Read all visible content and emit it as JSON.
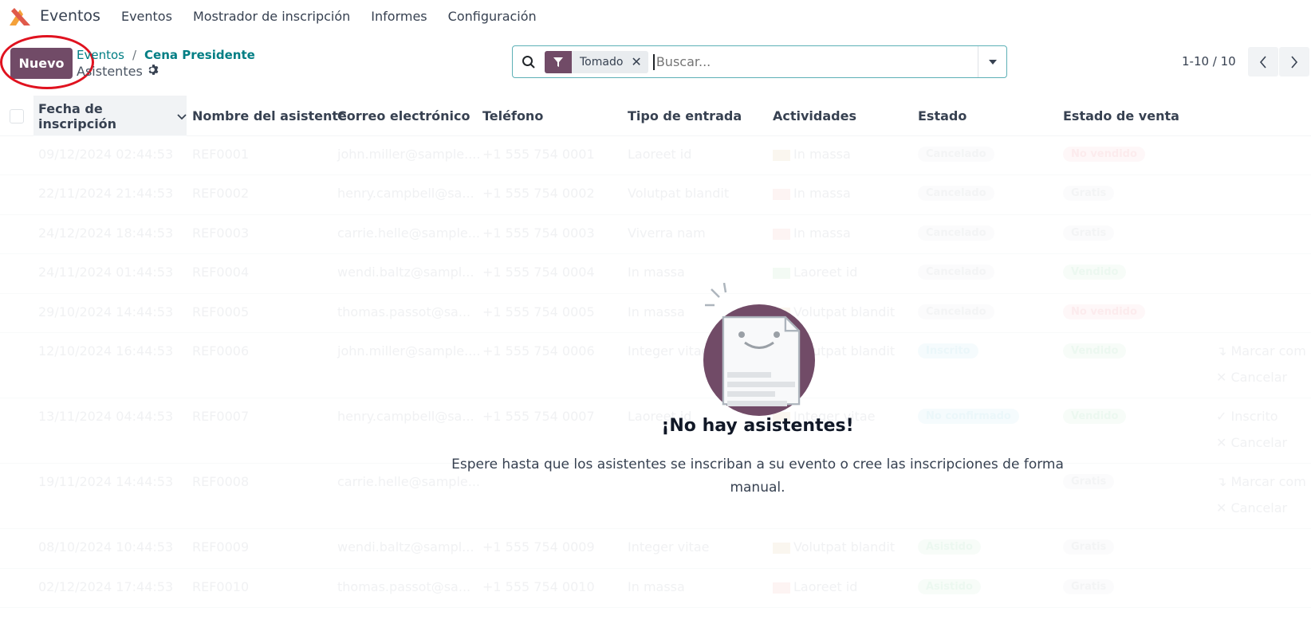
{
  "app": {
    "name": "Eventos"
  },
  "nav": {
    "items": [
      "Eventos",
      "Mostrador de inscripción",
      "Informes",
      "Configuración"
    ]
  },
  "control": {
    "new_button": "Nuevo",
    "breadcrumb": [
      "Eventos",
      "Cena Presidente"
    ],
    "sub_title": "Asistentes"
  },
  "search": {
    "facet": "Tomado",
    "placeholder": "Buscar..."
  },
  "pager": {
    "value": "1-10 / 10"
  },
  "table": {
    "headers": [
      "Fecha de inscripción",
      "Nombre del asistente",
      "Correo electrónico",
      "Teléfono",
      "Tipo de entrada",
      "Actividades",
      "Estado",
      "Estado de venta"
    ],
    "rows": [
      {
        "date": "09/12/2024 02:44:53",
        "name": "REF0001",
        "email": "john.miller@sample....",
        "phone": "+1 555 754 0001",
        "ticket": "Laoreet id",
        "activity": "In massa",
        "state": "Cancelado",
        "sale": "No vendido"
      },
      {
        "date": "22/11/2024 21:44:53",
        "name": "REF0002",
        "email": "henry.campbell@sa...",
        "phone": "+1 555 754 0002",
        "ticket": "Volutpat blandit",
        "activity": "In massa",
        "state": "Cancelado",
        "sale": "Gratis"
      },
      {
        "date": "24/12/2024 18:44:53",
        "name": "REF0003",
        "email": "carrie.helle@sample...",
        "phone": "+1 555 754 0003",
        "ticket": "Viverra nam",
        "activity": "In massa",
        "state": "Cancelado",
        "sale": "Gratis"
      },
      {
        "date": "24/11/2024 01:44:53",
        "name": "REF0004",
        "email": "wendi.baltz@sampl...",
        "phone": "+1 555 754 0004",
        "ticket": "In massa",
        "activity": "Laoreet id",
        "state": "Cancelado",
        "sale": "Vendido"
      },
      {
        "date": "29/10/2024 14:44:53",
        "name": "REF0005",
        "email": "thomas.passot@sa...",
        "phone": "+1 555 754 0005",
        "ticket": "In massa",
        "activity": "Volutpat blandit",
        "state": "Cancelado",
        "sale": "No vendido"
      },
      {
        "date": "12/10/2024 16:44:53",
        "name": "REF0006",
        "email": "john.miller@sample....",
        "phone": "+1 555 754 0006",
        "ticket": "Integer vitae",
        "activity": "Volutpat blandit",
        "state": "Inscrito",
        "sale": "Vendido",
        "actions": [
          "Marcar com",
          "Cancelar"
        ]
      },
      {
        "date": "13/11/2024 04:44:53",
        "name": "REF0007",
        "email": "henry.campbell@sa...",
        "phone": "+1 555 754 0007",
        "ticket": "Laoreet id",
        "activity": "Integer vitae",
        "state": "No confirmado",
        "sale": "Vendido",
        "actions": [
          "Inscrito",
          "Cancelar"
        ]
      },
      {
        "date": "19/11/2024 14:44:53",
        "name": "REF0008",
        "email": "carrie.helle@sample...",
        "phone": "",
        "ticket": "",
        "activity": "",
        "state": "",
        "sale": "Gratis",
        "actions": [
          "Marcar com",
          "Cancelar"
        ]
      },
      {
        "date": "08/10/2024 10:44:53",
        "name": "REF0009",
        "email": "wendi.baltz@sampl...",
        "phone": "+1 555 754 0009",
        "ticket": "Integer vitae",
        "activity": "Volutpat blandit",
        "state": "Asistido",
        "sale": "Gratis"
      },
      {
        "date": "02/12/2024 17:44:53",
        "name": "REF0010",
        "email": "thomas.passot@sa...",
        "phone": "+1 555 754 0010",
        "ticket": "In massa",
        "activity": "Laoreet id",
        "state": "Asistido",
        "sale": "Gratis"
      }
    ]
  },
  "helper": {
    "title": "¡No hay asistentes!",
    "description": "Espere hasta que los asistentes se inscriban a su evento o cree las inscripciones de forma manual."
  },
  "colors": {
    "primary": "#714b67",
    "link": "#017e84",
    "annotation": "#e0121f"
  }
}
